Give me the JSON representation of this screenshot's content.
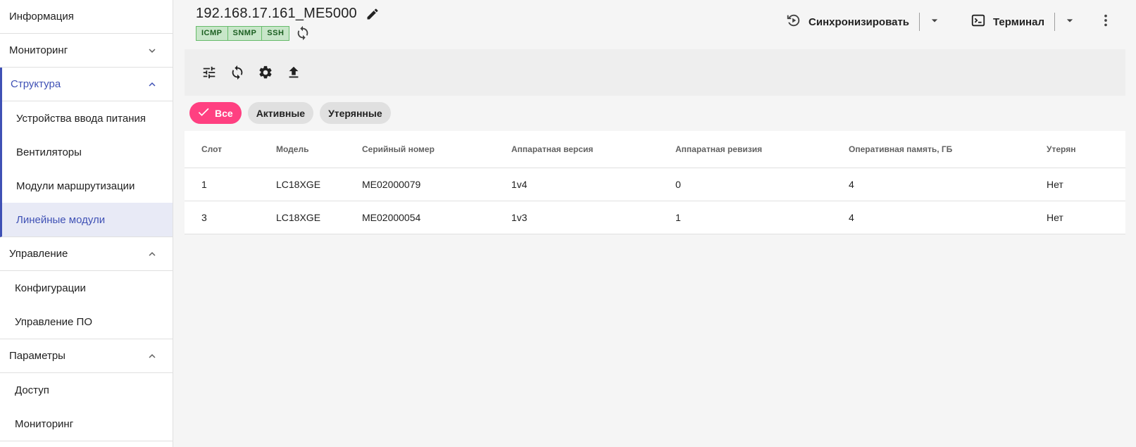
{
  "sidebar": {
    "items": [
      {
        "label": "Информация"
      },
      {
        "label": "Мониторинг"
      },
      {
        "label": "Структура"
      },
      {
        "label": "Устройства ввода питания"
      },
      {
        "label": "Вентиляторы"
      },
      {
        "label": "Модули маршрутизации"
      },
      {
        "label": "Линейные модули"
      },
      {
        "label": "Управление"
      },
      {
        "label": "Конфигурации"
      },
      {
        "label": "Управление ПО"
      },
      {
        "label": "Параметры"
      },
      {
        "label": "Доступ"
      },
      {
        "label": "Мониторинг"
      }
    ]
  },
  "header": {
    "title": "192.168.17.161_ME5000",
    "protocols": [
      "ICMP",
      "SNMP",
      "SSH"
    ],
    "sync_label": "Синхронизировать",
    "terminal_label": "Терминал"
  },
  "filters": {
    "all": "Все",
    "active": "Активные",
    "lost": "Утерянные"
  },
  "table": {
    "headers": [
      "Слот",
      "Модель",
      "Серийный номер",
      "Аппаратная версия",
      "Аппаратная ревизия",
      "Оперативная память, ГБ",
      "Утерян"
    ],
    "rows": [
      [
        "1",
        "LC18XGE",
        "ME02000079",
        "1v4",
        "0",
        "4",
        "Нет"
      ],
      [
        "3",
        "LC18XGE",
        "ME02000054",
        "1v3",
        "1",
        "4",
        "Нет"
      ]
    ]
  },
  "colors": {
    "accent": "#3f51b5",
    "chip_selected": "#ff4081",
    "protocol_bg": "#c8e6c9"
  }
}
